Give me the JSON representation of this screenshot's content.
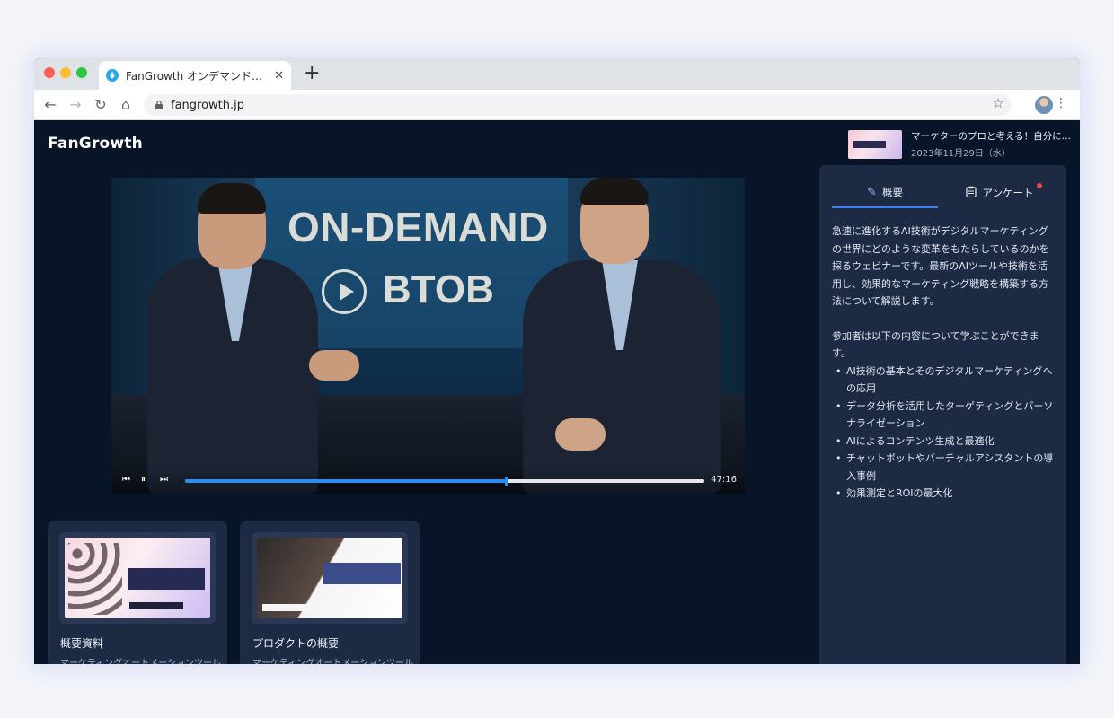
{
  "browser": {
    "tab_title": "FanGrowth オンデマンド配信…",
    "tab_close": "✕",
    "new_tab": "+",
    "url": "fangrowth.jp",
    "back": "←",
    "forward": "→",
    "reload": "↻",
    "home": "⌂",
    "star": "☆",
    "menu": "⋮",
    "lock": "🔒"
  },
  "header": {
    "logo": "FanGrowth",
    "event_title": "マーケターのプロと考える！自分に…",
    "event_date": "2023年11月29日（水）"
  },
  "video": {
    "headline": "ON-DEMAND",
    "subline": "BTOB",
    "time": "47:16",
    "progress": 0.62,
    "controls": {
      "prev": "⏮",
      "pause": "⏸",
      "next": "⏭"
    }
  },
  "cards": [
    {
      "title": "概要資料",
      "subtitle": "マーケティングオートメーションツール"
    },
    {
      "title": "プロダクトの概要",
      "subtitle": "マーケティングオートメーションツール"
    }
  ],
  "sidebar": {
    "tabs": [
      {
        "label": "概要",
        "icon": "pen-icon",
        "active": true
      },
      {
        "label": "アンケート",
        "icon": "clipboard-icon",
        "active": false,
        "notification": true
      }
    ],
    "description_1": "急速に進化するAI技術がデジタルマーケティングの世界にどのような変革をもたらしているのかを探るウェビナーです。最新のAIツールや技術を活用し、効果的なマーケティング戦略を構築する方法について解説します。",
    "description_2": "参加者は以下の内容について学ぶことができます。",
    "bullets": [
      "AI技術の基本とそのデジタルマーケティングへの応用",
      "データ分析を活用したターゲティングとパーソナライゼーション",
      "AIによるコンテンツ生成と最適化",
      "チャットボットやバーチャルアシスタントの導入事例",
      "効果測定とROIの最大化"
    ]
  },
  "colors": {
    "page_bg": "#081428",
    "panel_bg": "#1c2a44",
    "accent": "#3b82f6",
    "progress": "#2d8cf0",
    "notification": "#ef4444"
  }
}
